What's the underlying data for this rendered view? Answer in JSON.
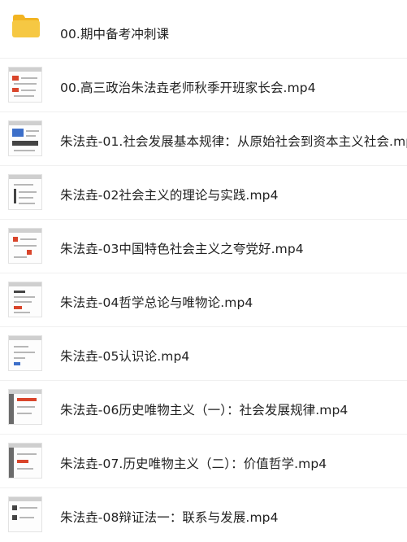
{
  "files": [
    {
      "name": "00.期中备考冲刺课",
      "type": "folder",
      "icon": "folder-icon"
    },
    {
      "name": "00.高三政治朱法垚老师秋季开班家长会.mp4",
      "type": "video",
      "icon": "video-thumbnail-icon"
    },
    {
      "name": "朱法垚-01.社会发展基本规律：从原始社会到资本主义社会.mp",
      "type": "video",
      "icon": "video-thumbnail-icon"
    },
    {
      "name": "朱法垚-02社会主义的理论与实践.mp4",
      "type": "video",
      "icon": "video-thumbnail-icon"
    },
    {
      "name": "朱法垚-03中国特色社会主义之夸党好.mp4",
      "type": "video",
      "icon": "video-thumbnail-icon"
    },
    {
      "name": "朱法垚-04哲学总论与唯物论.mp4",
      "type": "video",
      "icon": "video-thumbnail-icon"
    },
    {
      "name": "朱法垚-05认识论.mp4",
      "type": "video",
      "icon": "video-thumbnail-icon"
    },
    {
      "name": "朱法垚-06历史唯物主义（一）：社会发展规律.mp4",
      "type": "video",
      "icon": "video-thumbnail-icon"
    },
    {
      "name": "朱法垚-07.历史唯物主义（二）：价值哲学.mp4",
      "type": "video",
      "icon": "video-thumbnail-icon"
    },
    {
      "name": "朱法垚-08辩证法一：联系与发展.mp4",
      "type": "video",
      "icon": "video-thumbnail-icon"
    }
  ]
}
